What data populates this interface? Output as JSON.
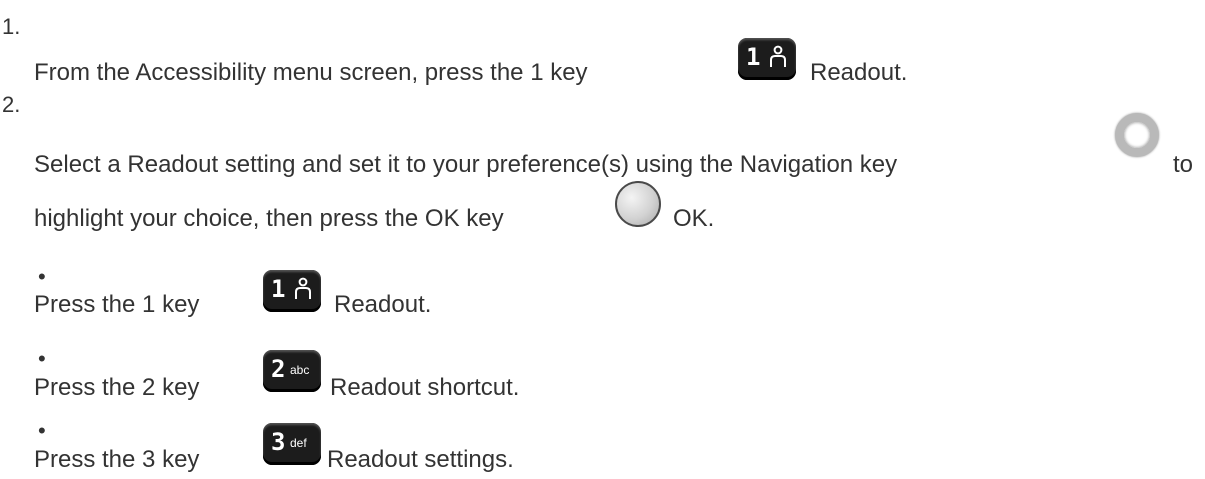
{
  "steps": [
    {
      "marker": "1.",
      "text_before": "From the Accessibility menu screen, press the 1 key",
      "key_icon": "key-1-icon",
      "text_after": "Readout."
    },
    {
      "marker": "2.",
      "line1_before": "Select a Readout setting and set it to your preference(s) using the Navigation key",
      "nav_icon": "navigation-key-icon",
      "line1_after": "to",
      "line2_before": "highlight your choice, then press the OK key",
      "ok_icon": "ok-key-icon",
      "line2_after": "OK."
    }
  ],
  "bullets": [
    {
      "marker": "•",
      "text_before": "Press the 1 key",
      "key_digit": "1",
      "key_sub": "",
      "text_after": "Readout."
    },
    {
      "marker": "•",
      "text_before": "Press the 2 key",
      "key_digit": "2",
      "key_sub": "abc",
      "text_after": "Readout shortcut."
    },
    {
      "marker": "•",
      "text_before": "Press the 3 key",
      "key_digit": "3",
      "key_sub": "def",
      "text_after": "Readout settings."
    }
  ],
  "colors": {
    "text": "#333333",
    "key_background": "#1c1c1c",
    "navigation_ring": "#b9b9b9"
  }
}
